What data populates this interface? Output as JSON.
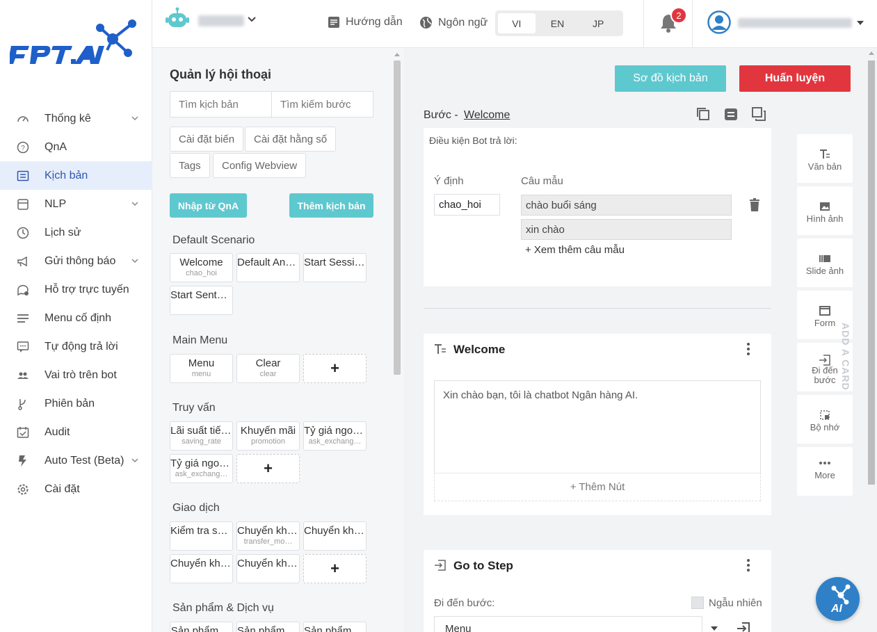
{
  "brand": {
    "logo_text": "FPT.AI"
  },
  "nav": {
    "items": [
      {
        "label": "Thống kê",
        "icon": "gauge-icon",
        "has_submenu": true
      },
      {
        "label": "QnA",
        "icon": "question-circle-icon",
        "has_submenu": false
      },
      {
        "label": "Kịch bản",
        "icon": "script-icon",
        "has_submenu": false,
        "active": true
      },
      {
        "label": "NLP",
        "icon": "database-icon",
        "has_submenu": true
      },
      {
        "label": "Lịch sử",
        "icon": "history-icon",
        "has_submenu": false
      },
      {
        "label": "Gửi thông báo",
        "icon": "megaphone-icon",
        "has_submenu": true
      },
      {
        "label": "Hỗ trợ trực tuyến",
        "icon": "chat-support-icon",
        "has_submenu": false
      },
      {
        "label": "Menu cố định",
        "icon": "menu-icon",
        "has_submenu": false
      },
      {
        "label": "Tự động trả lời",
        "icon": "auto-reply-icon",
        "has_submenu": false
      },
      {
        "label": "Vai trò trên bot",
        "icon": "users-icon",
        "has_submenu": false
      },
      {
        "label": "Phiên bản",
        "icon": "branch-icon",
        "has_submenu": false
      },
      {
        "label": "Audit",
        "icon": "calendar-check-icon",
        "has_submenu": false
      },
      {
        "label": "Auto Test (Beta)",
        "icon": "lightning-icon",
        "has_submenu": true
      },
      {
        "label": "Cài đặt",
        "icon": "gear-icon",
        "has_submenu": false
      }
    ]
  },
  "topbar": {
    "guide_label": "Hướng dẫn",
    "language_label": "Ngôn ngữ",
    "languages": [
      "VI",
      "EN",
      "JP"
    ],
    "active_language": "VI",
    "notification_count": "2"
  },
  "panel": {
    "title": "Quản lý hội thoại",
    "search_scenario_placeholder": "Tìm kịch bản",
    "search_step_placeholder": "Tìm kiếm bước",
    "chips": [
      "Cài đặt biến",
      "Cài đặt hằng số",
      "Tags",
      "Config Webview"
    ],
    "import_button": "Nhập từ QnA",
    "add_button": "Thêm kịch bản",
    "plus": "+",
    "groups": [
      {
        "title": "Default Scenario",
        "cards": [
          {
            "name": "Welcome",
            "sub": "chao_hoi"
          },
          {
            "name": "Default Ans…",
            "sub": ""
          },
          {
            "name": "Start Session",
            "sub": ""
          },
          {
            "name": "Start Sente…",
            "sub": ""
          }
        ]
      },
      {
        "title": "Main Menu",
        "cards": [
          {
            "name": "Menu",
            "sub": "menu"
          },
          {
            "name": "Clear",
            "sub": "clear"
          }
        ]
      },
      {
        "title": "Truy vấn",
        "cards": [
          {
            "name": "Lãi suất tiết…",
            "sub": "saving_rate"
          },
          {
            "name": "Khuyến mãi",
            "sub": "promotion"
          },
          {
            "name": "Tỷ giá ngoại…",
            "sub": "ask_exchang…"
          },
          {
            "name": "Tỷ giá ngoại…",
            "sub": "ask_exchang…"
          }
        ]
      },
      {
        "title": "Giao dịch",
        "cards": [
          {
            "name": "Kiểm tra số …",
            "sub": ""
          },
          {
            "name": "Chuyển kho…",
            "sub": "transfer_mo…"
          },
          {
            "name": "Chuyển kho…",
            "sub": ""
          },
          {
            "name": "Chuyển kho…",
            "sub": ""
          },
          {
            "name": "Chuyển kho…",
            "sub": ""
          }
        ]
      },
      {
        "title": "Sản phẩm & Dịch vụ",
        "cards": [
          {
            "name": "Sản phẩm …",
            "sub": ""
          },
          {
            "name": "Sản phẩm -…",
            "sub": ""
          },
          {
            "name": "Sản phẩm -…",
            "sub": ""
          }
        ]
      }
    ]
  },
  "main": {
    "diagram_button": "Sơ đồ kịch bản",
    "train_button": "Huấn luyện",
    "step_label": "Bước -",
    "step_name": "Welcome",
    "condition": {
      "title": "Điều kiện Bot trả lời:",
      "intent_header": "Ý định",
      "sample_header": "Câu mẫu",
      "intent_value": "chao_hoi",
      "samples": [
        "chào buổi sáng",
        "xin chào"
      ],
      "more_samples": "+ Xem thêm câu mẫu"
    },
    "text_card": {
      "title": "Welcome",
      "message": "Xin chào bạn, tôi là chatbot Ngân hàng AI.",
      "add_button": "+ Thêm Nút"
    },
    "goto_card": {
      "title": "Go to Step",
      "label": "Đi đến bước:",
      "random_label": "Ngẫu nhiên",
      "selected": "Menu"
    },
    "palette": [
      {
        "label": "Văn bản",
        "icon": "text-icon"
      },
      {
        "label": "Hình ảnh",
        "icon": "image-icon"
      },
      {
        "label": "Slide ảnh",
        "icon": "gallery-icon"
      },
      {
        "label": "Form",
        "icon": "form-icon"
      },
      {
        "label": "Đi đến bước",
        "icon": "goto-step-icon"
      },
      {
        "label": "Bộ nhớ",
        "icon": "memory-icon"
      },
      {
        "label": "More",
        "icon": "more-dots-icon"
      }
    ],
    "add_card_label": "ADD A CARD"
  },
  "colors": {
    "teal": "#5ec8cf",
    "red": "#e2363f",
    "brand_blue": "#1e5fc9",
    "active_bg": "#e6eefb"
  }
}
